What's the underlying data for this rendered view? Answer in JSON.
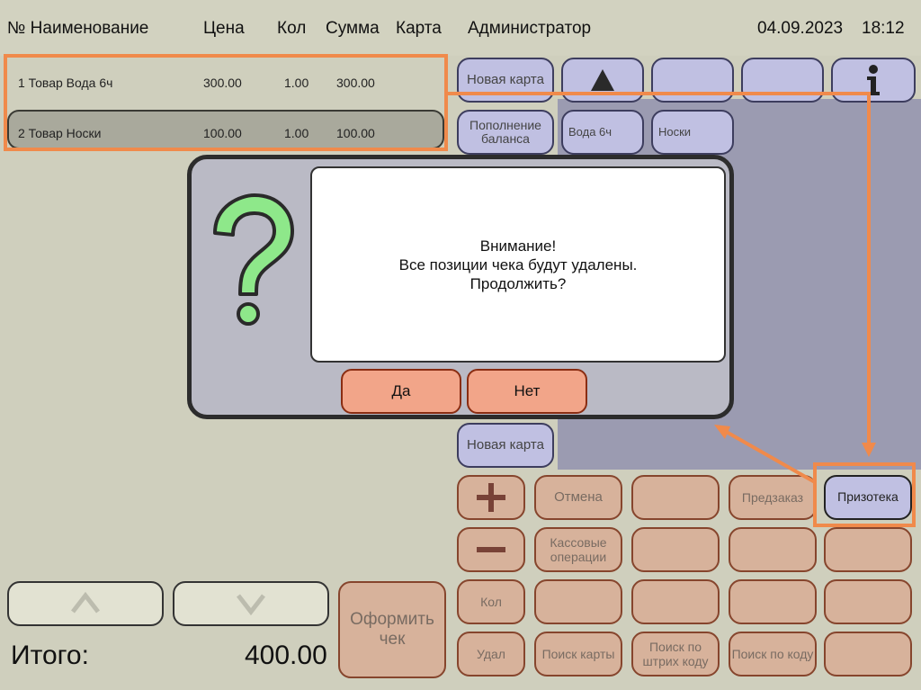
{
  "header": {
    "col_name": "№ Наименование",
    "col_price": "Цена",
    "col_qty": "Кол",
    "col_sum": "Сумма",
    "col_card": "Карта",
    "operator": "Администратор",
    "date": "04.09.2023",
    "time": "18:12"
  },
  "receipt": {
    "rows": [
      {
        "name": "1 Товар Вода 6ч",
        "price": "300.00",
        "qty": "1.00",
        "sum": "300.00"
      },
      {
        "name": "2 Товар Носки",
        "price": "100.00",
        "qty": "1.00",
        "sum": "100.00"
      }
    ],
    "total_label": "Итого:",
    "total_value": "400.00"
  },
  "goods": {
    "new_card": "Новая карта",
    "top_up_balance": "Пополнение баланса",
    "water_6h": "Вода 6ч",
    "socks": "Носки",
    "new_card_2": "Новая карта"
  },
  "dialog": {
    "line1": "Внимание!",
    "line2": "Все позиции чека будут удалены.",
    "line3": "Продолжить?",
    "yes": "Да",
    "no": "Нет"
  },
  "keypad": {
    "cancel": "Отмена",
    "preorder": "Предзаказ",
    "prize_store": "Призотека",
    "cash_operations": "Кассовые операции",
    "qty": "Кол",
    "delete": "Удал",
    "search_card": "Поиск карты",
    "search_barcode": "Поиск по штрих коду",
    "search_code": "Поиск по коду",
    "checkout": "Оформить чек"
  },
  "colors": {
    "background": "#cfcfbd",
    "tile_blue": "#c0c0e2",
    "key_salmon": "#d9ad96",
    "dialog_button": "#f2a589",
    "highlight": "#f08a4b",
    "question_green": "#8ee88a"
  },
  "icons": {
    "question": "question-mark-icon",
    "up_arrow": "arrow-up-icon",
    "info": "info-icon",
    "plus": "plus-icon",
    "minus": "minus-icon",
    "scroll_up": "chevron-up-icon",
    "scroll_down": "chevron-down-icon"
  }
}
